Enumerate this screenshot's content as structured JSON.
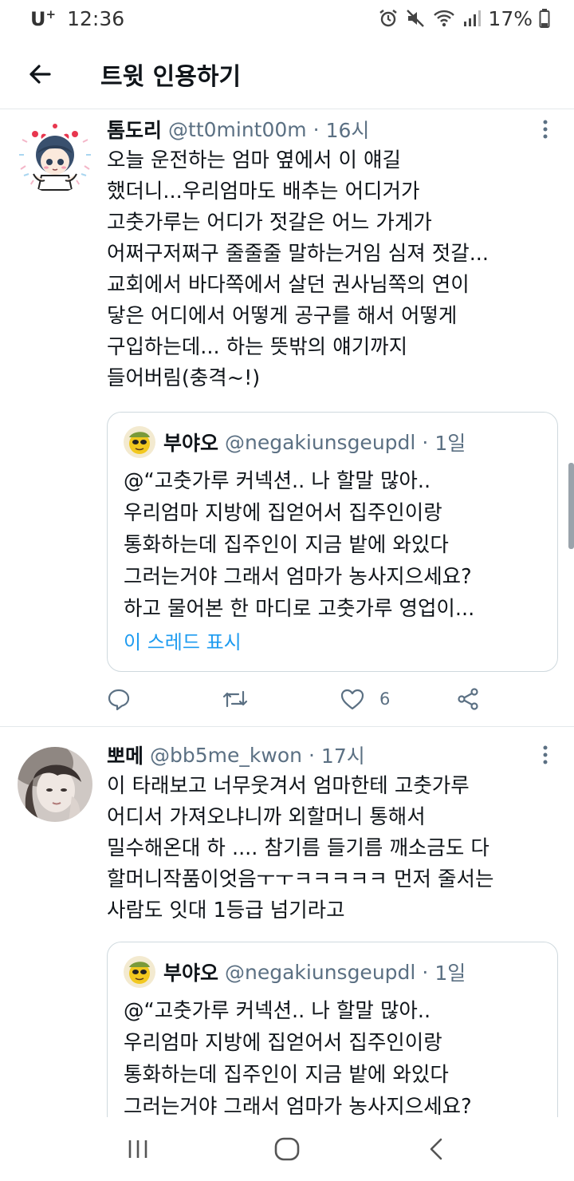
{
  "status_bar": {
    "carrier": "U",
    "carrier_sup": "+",
    "time": "12:36",
    "battery": "17%"
  },
  "header": {
    "title": "트윗 인용하기"
  },
  "tweets": [
    {
      "display_name": "톰도리",
      "handle": "@tt0mint00m",
      "dot": "·",
      "time": "16시",
      "text": "오늘 운전하는 엄마 옆에서 이 얘길\n했더니...우리엄마도 배추는 어디거가\n고춧가루는 어디가 젓갈은 어느 가게가\n어쩌구저쩌구 줄줄줄 말하는거임 심져 젓갈...\n교회에서 바다쪽에서 살던 권사님쪽의 연이\n닿은 어디에서 어떻게 공구를 해서 어떻게\n구입하는데... 하는 뜻밖의 얘기까지\n들어버림(충격~!)",
      "quote": {
        "display_name": "부야오",
        "handle": "@negakiunsgeupdl",
        "dot": "·",
        "time": "1일",
        "text": "@“고춧가루 커넥션.. 나 할말 많아..\n우리엄마 지방에 집얻어서 집주인이랑\n통화하는데 집주인이 지금 밭에 와있다\n그러는거야 그래서 엄마가 농사지으세요?\n하고 물어본 한 마디로 고춧가루 영업이...",
        "show_thread": "이 스레드 표시"
      },
      "actions": {
        "like_count": "6"
      }
    },
    {
      "display_name": "뽀메",
      "handle": "@bb5me_kwon",
      "dot": "·",
      "time": "17시",
      "text": "이 타래보고 너무웃겨서 엄마한테 고춧가루\n어디서 가져오냐니까 외할머니 통해서\n밀수해온대 하 .... 참기름 들기름 깨소금도 다\n할머니작품이엇음ㅜㅜㅋㅋㅋㅋㅋ 먼저 줄서는\n사람도 잇대 1등급 넘기라고",
      "quote": {
        "display_name": "부야오",
        "handle": "@negakiunsgeupdl",
        "dot": "·",
        "time": "1일",
        "text": "@“고춧가루 커넥션.. 나 할말 많아..\n우리엄마 지방에 집얻어서 집주인이랑\n통화하는데 집주인이 지금 밭에 와있다\n그러는거야 그래서 엄마가 농사지으세요?"
      }
    }
  ],
  "icons": {
    "back": "arrow-left-icon",
    "more": "more-vertical-icon",
    "reply": "reply-icon",
    "retweet": "retweet-icon",
    "like": "heart-icon",
    "share": "share-icon",
    "nav_recents": "recents-icon",
    "nav_home": "home-icon",
    "nav_back": "back-chevron-icon"
  },
  "colors": {
    "link": "#1d9bf0",
    "secondary_text": "#5b7083",
    "divider": "#e4e8eb"
  }
}
